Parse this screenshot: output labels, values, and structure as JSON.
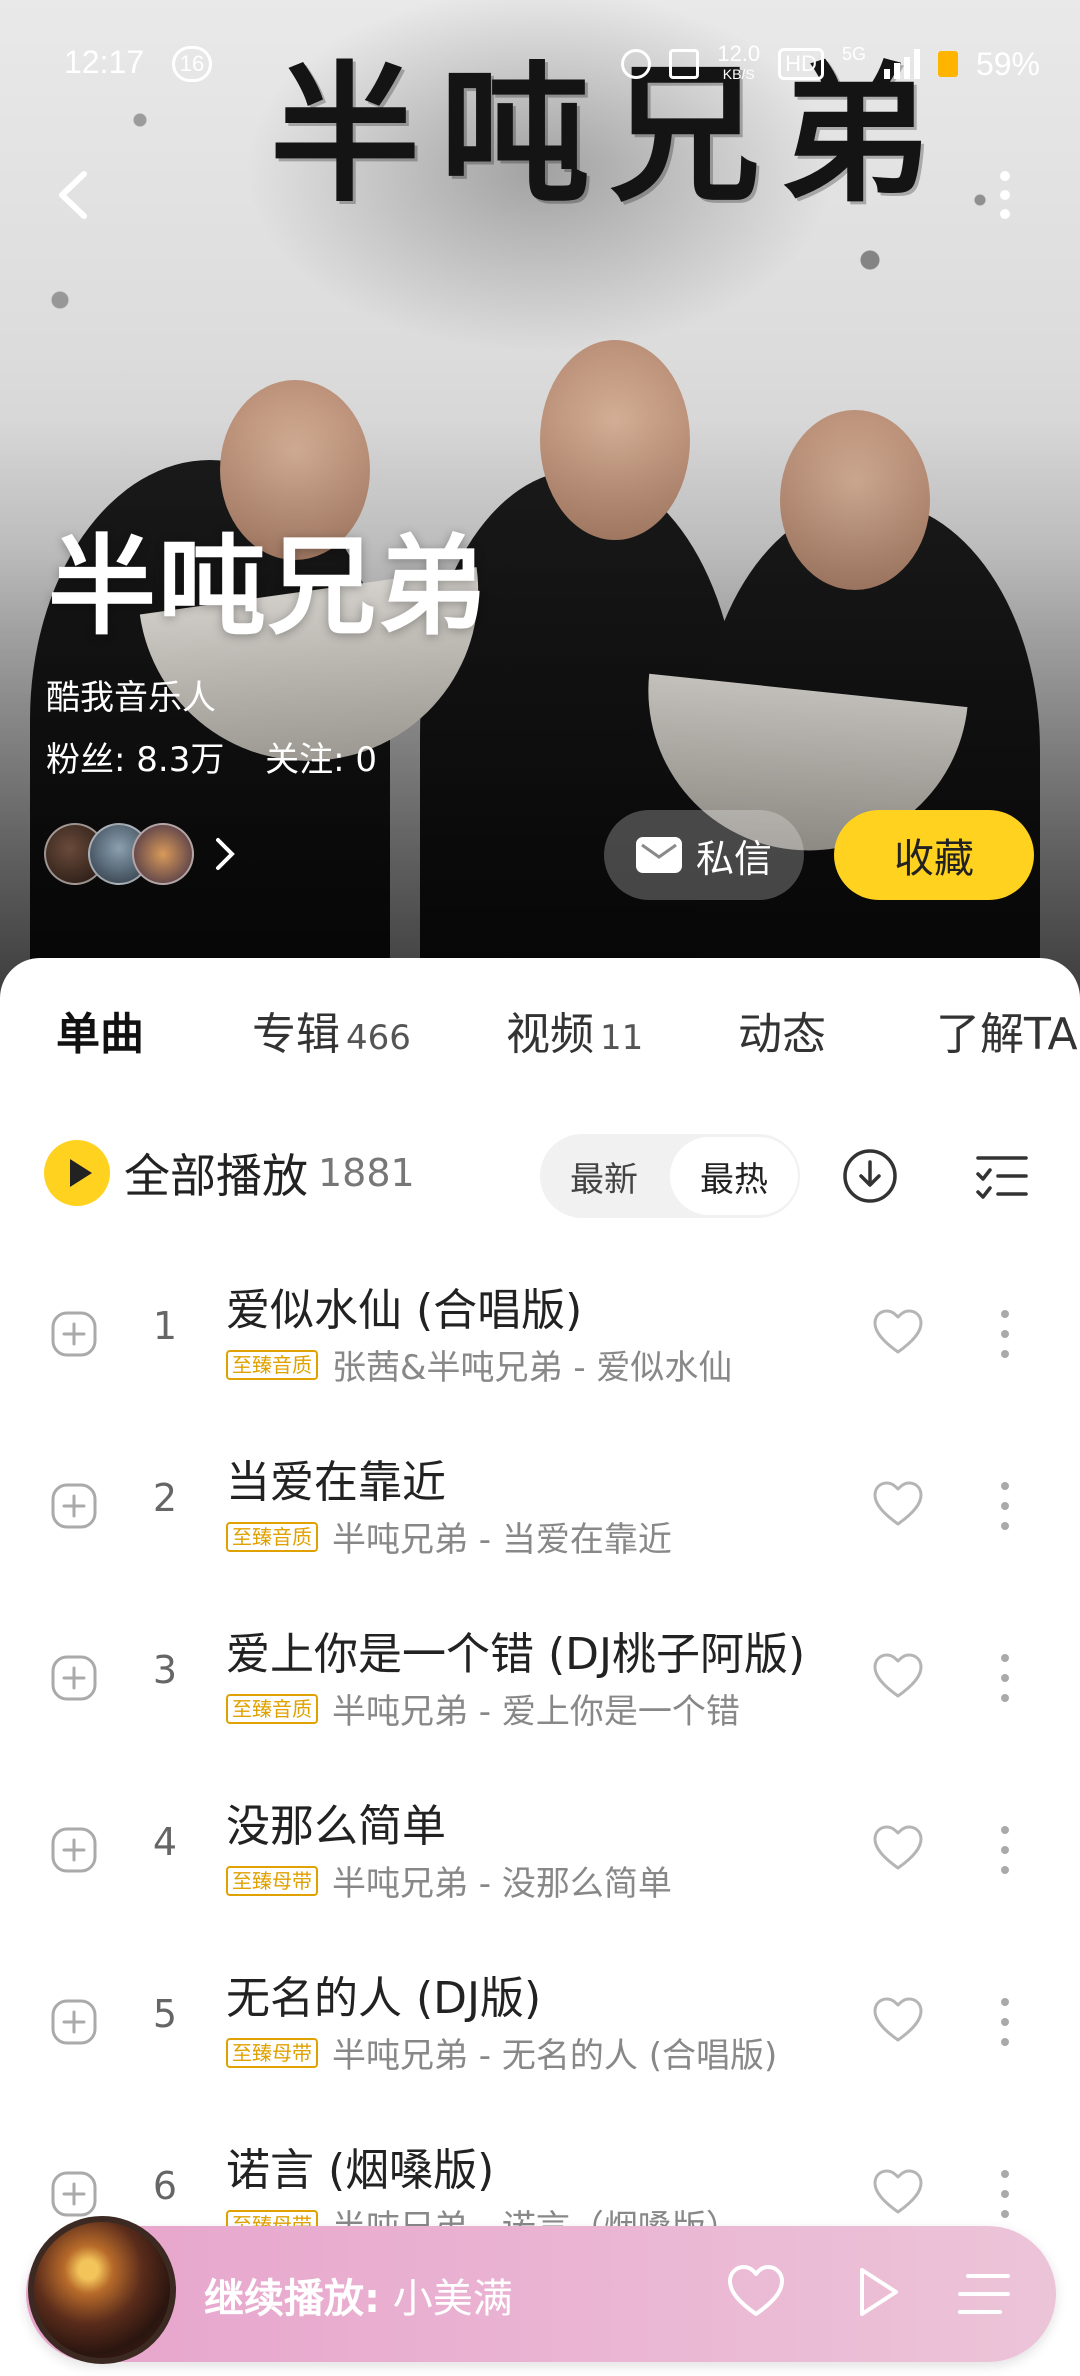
{
  "status_bar": {
    "time": "12:17",
    "notification_count": "16",
    "speed_value": "12.0",
    "speed_unit": "KB/S",
    "hd_label": "HD",
    "network": "5G",
    "battery": "59%"
  },
  "hero": {
    "calligraphy_title": "半吨兄弟",
    "artist_name": "半吨兄弟",
    "artist_tag": "酷我音乐人",
    "fans_label": "粉丝: 8.3万",
    "following_label": "关注: 0",
    "message_label": "私信",
    "favorite_label": "收藏"
  },
  "tabs": [
    {
      "label": "单曲",
      "count": ""
    },
    {
      "label": "专辑",
      "count": "466"
    },
    {
      "label": "视频",
      "count": "11"
    },
    {
      "label": "动态",
      "count": ""
    },
    {
      "label": "了解TA",
      "count": ""
    }
  ],
  "toolbar": {
    "play_all_label": "全部播放",
    "play_all_count": "1881",
    "sort_latest": "最新",
    "sort_hottest": "最热"
  },
  "songs": [
    {
      "index": "1",
      "title": "爱似水仙 (合唱版)",
      "badge": "至臻音质",
      "subtitle": "张茜&半吨兄弟 - 爱似水仙"
    },
    {
      "index": "2",
      "title": "当爱在靠近",
      "badge": "至臻音质",
      "subtitle": "半吨兄弟 - 当爱在靠近"
    },
    {
      "index": "3",
      "title": "爱上你是一个错 (DJ桃子阿版)",
      "badge": "至臻音质",
      "subtitle": "半吨兄弟 - 爱上你是一个错"
    },
    {
      "index": "4",
      "title": "没那么简单",
      "badge": "至臻母带",
      "subtitle": "半吨兄弟 - 没那么简单"
    },
    {
      "index": "5",
      "title": "无名的人 (DJ版)",
      "badge": "至臻母带",
      "subtitle": "半吨兄弟 - 无名的人 (合唱版)"
    },
    {
      "index": "6",
      "title": "诺言 (烟嗓版)",
      "badge": "至臻母带",
      "subtitle": "半吨兄弟 - 诺言（烟嗓版）"
    }
  ],
  "player": {
    "continue_label": "继续播放:",
    "track": "小美满"
  },
  "colors": {
    "accent": "#ffd21f",
    "badge": "#e0a200",
    "player_bg": "#e9abcf"
  }
}
